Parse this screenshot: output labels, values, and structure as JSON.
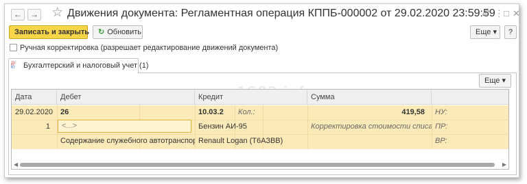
{
  "window": {
    "title": "Движения документа: Регламентная операция КППБ-000002 от 29.02.2020 23:59:59",
    "nav_back": "←",
    "nav_forward": "→",
    "star": "☆",
    "link_icon": "🔗",
    "menu_icon": "⋮",
    "maximize_icon": "□",
    "close_icon": "✕"
  },
  "toolbar": {
    "save_close_label": "Записать и закрыть",
    "refresh_label": "Обновить",
    "more_label": "Еще ▾",
    "help_label": "?"
  },
  "manual_correction": {
    "label": "Ручная корректировка (разрешает редактирование движений документа)",
    "checked": false
  },
  "tab": {
    "label": "Бухгалтерский и налоговый учет (1)",
    "icon_top": "Дт",
    "icon_bottom": "Кт"
  },
  "table_toolbar": {
    "more_label": "Еще ▾"
  },
  "watermark": "1S83.info",
  "table": {
    "columns": [
      "Дата",
      "Дебет",
      "Кредит",
      "Сумма"
    ],
    "rows": {
      "date": "29.02.2020",
      "line_no": "1",
      "debit_account": "26",
      "debit_subconto1": "<...>",
      "debit_subconto2": "Содержание служебного автотранспорта",
      "credit_account": "10.03.2",
      "credit_qty_label": "Кол.:",
      "credit_subconto1": "Бензин АИ-95",
      "credit_subconto2": "Renault Logan (Т6АЗВВ)",
      "amount": "419,58",
      "description": "Корректировка стоимости списания",
      "nu_label": "НУ:",
      "pr_label": "ПР:",
      "vr_label": "ВР:"
    }
  },
  "colors": {
    "primary_button": "#f9d548",
    "selected_row": "#fcebb8",
    "refresh_icon": "#3f9f3f"
  }
}
